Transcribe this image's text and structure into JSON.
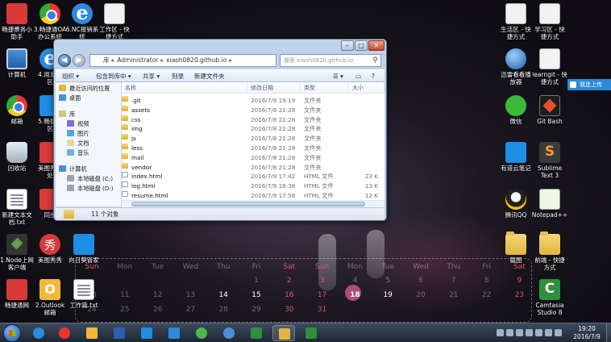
{
  "desktop": {
    "icons_left": [
      {
        "label": "畅捷票务小\n助手",
        "icon": "app-icon"
      },
      {
        "label": "3.畅捷通OA\n办公系统",
        "icon": "chrome-icon"
      },
      {
        "label": "6.NC报销系\n统",
        "icon": "ie-icon"
      },
      {
        "label": "工作区 - 快\n捷方式",
        "icon": "shortcut-doc-icon"
      },
      {
        "label": "计算机",
        "icon": "computer-icon"
      },
      {
        "label": "4.用友云\n区",
        "icon": "ie-icon"
      },
      {
        "label": "邮箱",
        "icon": "chrome-icon"
      },
      {
        "label": "5.畅捷通\n区",
        "icon": "cloud-icon"
      },
      {
        "label": "回收站",
        "icon": "recycle-bin-icon"
      },
      {
        "label": "美图秀秀\n处",
        "icon": "app-icon"
      },
      {
        "label": "新建文本文\n档.txt",
        "icon": "text-file-icon"
      },
      {
        "label": "同步",
        "icon": "app-icon"
      },
      {
        "label": "1.Node上网\n客户端",
        "icon": "node-icon"
      },
      {
        "label": "美图秀秀",
        "icon": "meitu-icon"
      },
      {
        "label": "向日葵管家",
        "icon": "cloud-icon"
      },
      {
        "label": "畅捷通网",
        "icon": "chanjet-icon"
      },
      {
        "label": "2.Outlook\n邮箱",
        "icon": "outlook-icon"
      },
      {
        "label": "工作篇.txt",
        "icon": "text-file-icon"
      }
    ],
    "icons_right": [
      {
        "label": "生活区 - 快\n捷方式",
        "icon": "shortcut-doc-icon"
      },
      {
        "label": "学习区 - 快\n捷方式",
        "icon": "shortcut-doc-icon"
      },
      {
        "label": "迅雷看看播\n放器",
        "icon": "globe-icon"
      },
      {
        "label": "learngit - 快\n捷方式",
        "icon": "shortcut-doc-icon"
      },
      {
        "label": "微信",
        "icon": "wechat-icon"
      },
      {
        "label": "Git Bash",
        "icon": "git-bash-icon"
      },
      {
        "label": "有道云笔记",
        "icon": "cloud-icon"
      },
      {
        "label": "Sublime\nText 3",
        "icon": "sublime-icon"
      },
      {
        "label": "腾讯QQ",
        "icon": "qq-icon"
      },
      {
        "label": "Notepad++",
        "icon": "notepad-icon"
      },
      {
        "label": "截图",
        "icon": "folder-icon"
      },
      {
        "label": "前端 - 快捷\n方式",
        "icon": "folder-icon"
      },
      {
        "label": "Camtasia\nStudio 8",
        "icon": "camtasia-icon"
      }
    ],
    "chip_label": "我连上传"
  },
  "calendar": {
    "weekdays": [
      "Sun",
      "Mon",
      "Tue",
      "Wed",
      "Thu",
      "Fri",
      "Sat",
      "Sun",
      "Mon",
      "Tue",
      "Wed",
      "Thu",
      "Fri",
      "Sat"
    ],
    "rows": [
      [
        "",
        "",
        "",
        "",
        "",
        "1",
        "2",
        "3",
        "4",
        "5",
        "6",
        "7",
        "8",
        "9"
      ],
      [
        "10",
        "11",
        "12",
        "13",
        "14",
        "15",
        "16",
        "17",
        "18",
        "19",
        "20",
        "21",
        "22",
        "23"
      ],
      [
        "24",
        "25",
        "26",
        "27",
        "28",
        "29",
        "30",
        "31",
        "",
        "",
        "",
        "",
        "",
        ""
      ]
    ],
    "today": "18"
  },
  "explorer": {
    "address": [
      "库",
      "Administrator",
      "xiaoh0820.github.io"
    ],
    "search_placeholder": "搜索 xiaoh0820.github.io",
    "toolbar": {
      "organize": "组织 ▾",
      "include_in_library": "包含到库中 ▾",
      "share": "共享 ▾",
      "burn": "刻录",
      "new_folder": "新建文件夹"
    },
    "nav": [
      {
        "label": "最近访问的位置",
        "icon": "recent-places-icon"
      },
      {
        "label": "桌面",
        "icon": "desktop-icon"
      },
      {
        "label": "库",
        "icon": "library-icon"
      },
      {
        "label": "视频",
        "icon": "video-library-icon"
      },
      {
        "label": "图片",
        "icon": "pictures-library-icon"
      },
      {
        "label": "文档",
        "icon": "documents-library-icon"
      },
      {
        "label": "音乐",
        "icon": "music-library-icon"
      },
      {
        "label": "计算机",
        "icon": "computer-icon"
      },
      {
        "label": "本地磁盘 (C:)",
        "icon": "drive-icon"
      },
      {
        "label": "本地磁盘 (D:)",
        "icon": "drive-icon"
      }
    ],
    "columns": {
      "name": "名称",
      "date": "修改日期",
      "type": "类型",
      "size": "大小"
    },
    "files": [
      {
        "name": ".git",
        "date": "2016/7/9 19:19",
        "type": "文件夹",
        "size": "",
        "kind": "folder"
      },
      {
        "name": "assets",
        "date": "2016/7/8 21:28",
        "type": "文件夹",
        "size": "",
        "kind": "folder"
      },
      {
        "name": "css",
        "date": "2016/7/8 21:28",
        "type": "文件夹",
        "size": "",
        "kind": "folder"
      },
      {
        "name": "img",
        "date": "2016/7/8 21:28",
        "type": "文件夹",
        "size": "",
        "kind": "folder"
      },
      {
        "name": "js",
        "date": "2016/7/8 21:28",
        "type": "文件夹",
        "size": "",
        "kind": "folder"
      },
      {
        "name": "less",
        "date": "2016/7/8 21:28",
        "type": "文件夹",
        "size": "",
        "kind": "folder"
      },
      {
        "name": "mail",
        "date": "2016/7/8 21:28",
        "type": "文件夹",
        "size": "",
        "kind": "folder"
      },
      {
        "name": "vendor",
        "date": "2016/7/8 21:28",
        "type": "文件夹",
        "size": "",
        "kind": "folder"
      },
      {
        "name": "index.html",
        "date": "2016/7/9 17:42",
        "type": "HTML 文件",
        "size": "23 K",
        "kind": "html"
      },
      {
        "name": "log.html",
        "date": "2016/7/9 18:38",
        "type": "HTML 文件",
        "size": "13 K",
        "kind": "html"
      },
      {
        "name": "resume.html",
        "date": "2016/7/9 17:58",
        "type": "HTML 文件",
        "size": "12 K",
        "kind": "html"
      }
    ],
    "status": "11 个对象"
  },
  "taskbar": {
    "apps": [
      {
        "icon": "ie-icon",
        "color": "#2a8be0"
      },
      {
        "icon": "chrome-icon",
        "color": "#e33"
      },
      {
        "icon": "outlook-icon",
        "color": "#f3b73a"
      },
      {
        "icon": "word-icon",
        "color": "#2b5fb3"
      },
      {
        "icon": "youdao-cloud-icon",
        "color": "#1d8ee3"
      },
      {
        "icon": "sunflower-icon",
        "color": "#2a8be0"
      },
      {
        "icon": "green-app-icon",
        "color": "#4cb84c"
      },
      {
        "icon": "globe-icon",
        "color": "#4a90d9"
      },
      {
        "icon": "camtasia-icon",
        "color": "#2e8f3d"
      },
      {
        "icon": "explorer-icon",
        "color": "#e0b541"
      },
      {
        "icon": "camtasia-recorder-icon",
        "color": "#2e8f3d"
      }
    ],
    "time": "19:20",
    "date": "2016/7/9"
  }
}
